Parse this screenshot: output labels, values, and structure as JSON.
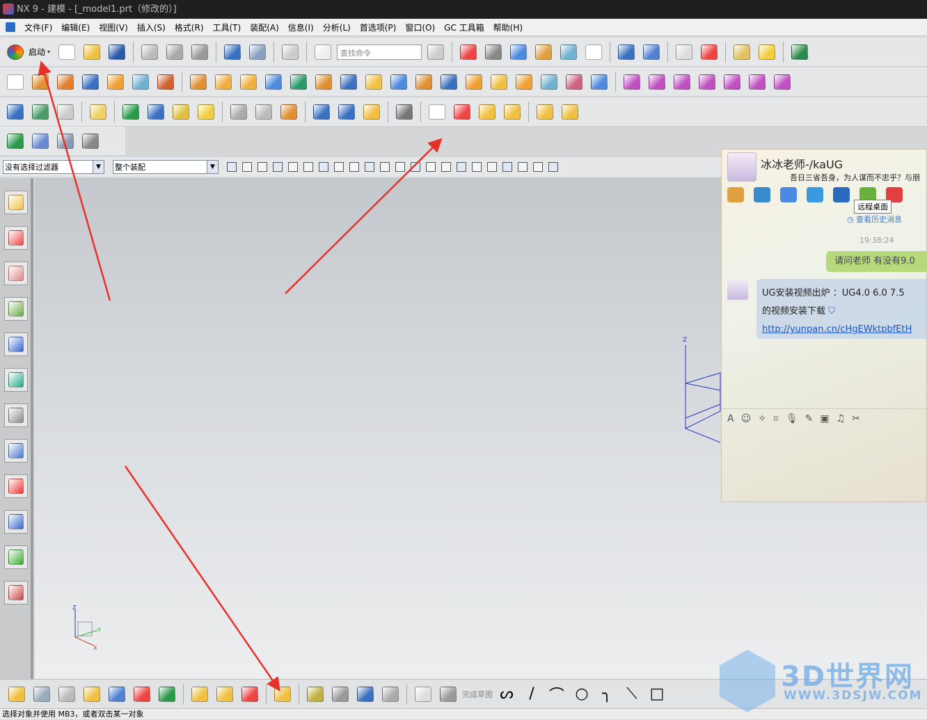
{
  "window": {
    "title": "NX 9 - 建模 - [_model1.prt（修改的）]"
  },
  "menu": [
    "文件(F)",
    "编辑(E)",
    "视图(V)",
    "插入(S)",
    "格式(R)",
    "工具(T)",
    "装配(A)",
    "信息(I)",
    "分析(L)",
    "首选项(P)",
    "窗口(O)",
    "GC 工具箱",
    "帮助(H)"
  ],
  "toolbar": {
    "start_label": "启动",
    "search_placeholder": "查找命令",
    "row1": [
      [
        "new-file",
        "#fff"
      ],
      [
        "open-folder",
        "#f0c040"
      ],
      [
        "save",
        "#2a5aa8"
      ],
      "|",
      [
        "cut",
        "#bbb"
      ],
      [
        "copy",
        "#aaa"
      ],
      [
        "paste",
        "#999"
      ],
      "|",
      [
        "undo",
        "#3a70c0"
      ],
      [
        "redo",
        "#8aa0c0"
      ],
      "|",
      [
        "repeat-command",
        "#ccc"
      ],
      "|",
      [
        "information",
        "#eee"
      ]
    ],
    "row1b": [
      [
        "fit-view",
        "#e44"
      ],
      [
        "render-style",
        "#888"
      ],
      [
        "shaded",
        "#4a8ae0"
      ],
      [
        "section",
        "#e0a040"
      ],
      [
        "view-orient",
        "#70b0d0"
      ],
      [
        "background",
        "#fff"
      ],
      "|",
      [
        "wcs",
        "#3a70c0"
      ],
      [
        "wcs-dynamic",
        "#5080d0"
      ],
      "|",
      [
        "layer-settings",
        "#ddd"
      ],
      [
        "snap",
        "#e44"
      ],
      "|",
      [
        "sketch",
        "#e0c060"
      ],
      [
        "paint",
        "#f0d040"
      ],
      "|",
      [
        "play",
        "#2a8a4a"
      ]
    ],
    "row2": [
      [
        "sketch-plane",
        "#fff"
      ],
      [
        "extrude",
        "#e09030"
      ],
      [
        "revolve",
        "#e08030"
      ],
      [
        "block",
        "#3a70c0"
      ],
      [
        "cylinder",
        "#f0a030"
      ],
      [
        "cone",
        "#70b0d0"
      ],
      [
        "sphere",
        "#d06030"
      ],
      "|",
      [
        "hole",
        "#e09030"
      ],
      [
        "boss",
        "#f0b040"
      ],
      [
        "pocket",
        "#f0b040"
      ],
      [
        "pad",
        "#4a8ae0"
      ],
      [
        "slot",
        "#2a9a6a"
      ],
      [
        "groove",
        "#e09030"
      ],
      [
        "thread",
        "#3a70c0"
      ],
      [
        "trim-body",
        "#f0c040"
      ],
      [
        "split-body",
        "#4a8ae0"
      ],
      [
        "sew",
        "#e09030"
      ],
      [
        "patch",
        "#3a70c0"
      ],
      [
        "edge-blend",
        "#f0a030"
      ],
      [
        "chamfer",
        "#f0c040"
      ],
      [
        "shell",
        "#f0a030"
      ],
      [
        "face-blend",
        "#70b0d0"
      ],
      [
        "draft",
        "#d06080"
      ],
      [
        "offset-face",
        "#4a8ae0"
      ],
      "|",
      [
        "move-face",
        "#c050c0"
      ],
      [
        "replace-face",
        "#c050c0"
      ],
      [
        "delete-face",
        "#c050c0"
      ],
      [
        "copy-face",
        "#c050c0"
      ],
      [
        "paste-face",
        "#c050c0"
      ],
      [
        "mirror-face",
        "#c050c0"
      ],
      [
        "pattern-face",
        "#c050c0"
      ]
    ],
    "row3": [
      [
        "assembly-nav",
        "#3a70c0"
      ],
      [
        "layers",
        "#4a9a6a"
      ],
      [
        "part-list",
        "#ccc"
      ],
      "|",
      [
        "label",
        "#f0d060"
      ],
      "|",
      [
        "check-geometry",
        "#2a9a4a"
      ],
      [
        "hammer",
        "#3a70c0"
      ],
      [
        "face-analysis",
        "#e0c040"
      ],
      [
        "text-note",
        "#f0d040"
      ],
      "|",
      [
        "curve-analysis",
        "#aaa"
      ],
      [
        "surface-analysis",
        "#bbb"
      ],
      [
        "draft-analysis",
        "#e09030"
      ],
      "|",
      [
        "spring",
        "#3a70c0"
      ],
      [
        "spring-coil",
        "#3a70c0"
      ],
      [
        "ring",
        "#f0c040"
      ],
      "|",
      [
        "tool",
        "#777"
      ],
      "|",
      [
        "triangle",
        "#fff"
      ],
      [
        "table",
        "#e44"
      ],
      [
        "folder-star",
        "#f0c040"
      ],
      [
        "settings-group",
        "#f0c040"
      ],
      "|",
      [
        "component-a",
        "#f0c040"
      ],
      [
        "component-b",
        "#f0c040"
      ]
    ],
    "row4": [
      [
        "check-mate",
        "#2a9a4a"
      ],
      [
        "assembly-constraint",
        "#6a8ad0"
      ],
      [
        "deformable",
        "#8a9ab0"
      ],
      [
        "csys",
        "#888"
      ]
    ]
  },
  "selection_bar": {
    "filter": "没有选择过滤器",
    "scope": "整个装配"
  },
  "left_toolbar": [
    "assembly-navigator",
    "constraint-navigator",
    "part-navigator",
    "reuse-library",
    "history",
    "web-browser",
    "history-clock",
    "process-studio",
    "visualization-palette",
    "roles-dynamic",
    "roles",
    "system-materials"
  ],
  "bottom_toolbar": {
    "items": [
      [
        "add-component",
        "#f0c040"
      ],
      [
        "wave-geometry",
        "#9ab"
      ],
      [
        "new-parent",
        "#bbb"
      ],
      [
        "create-array",
        "#f0c040"
      ],
      [
        "move-component",
        "#5080d0"
      ],
      [
        "mirror-assembly",
        "#e44"
      ],
      [
        "assembly-constraints",
        "#2a9a4a"
      ],
      "|",
      [
        "explode",
        "#f0c040"
      ],
      [
        "sequence",
        "#f0c040"
      ],
      [
        "replace-component",
        "#e44"
      ],
      "|",
      [
        "product-interface",
        "#f0c040"
      ],
      "|",
      [
        "link",
        "#c0b040"
      ],
      [
        "wave-link",
        "#999"
      ],
      [
        "wave-info",
        "#3a70c0"
      ],
      [
        "clearance",
        "#aaa"
      ],
      "|",
      [
        "sketch-new",
        "#ddd"
      ],
      [
        "finish-sketch-grid",
        "#999"
      ]
    ],
    "finish_sketch_label": "完成草图",
    "sketch_tools": [
      "profile",
      "line",
      "arc",
      "circle",
      "fillet",
      "chamfer",
      "rectangle"
    ]
  },
  "status_bar": {
    "text": "选择对象并使用 MB3，或者双击某一对象"
  },
  "chat": {
    "name": "冰冰老师-/kaUG",
    "signature": "吾日三省吾身，为人谋而不忠乎？与朋",
    "tooltip": "远程桌面",
    "history_link": "查看历史消息",
    "time": "19:38:24",
    "my_message": "请问老师  有没有9.0",
    "their_line1": "UG安装视频出炉  ：UG4.0  6.0  7.5",
    "their_line2": "的视频安装下载",
    "their_link": "http://yunpan.cn/cHgEWktpbfEtH",
    "tools": [
      [
        "microphone",
        "#e0a040"
      ],
      [
        "webcam",
        "#3a8ad0"
      ],
      [
        "screen-share",
        "#4a8ae0"
      ],
      [
        "send-file",
        "#3a9ae0"
      ],
      [
        "remote-desktop",
        "#2a6ac0"
      ],
      [
        "note-add",
        "#6ab040"
      ],
      [
        "apps",
        "#e04040"
      ]
    ]
  },
  "watermark": {
    "title": "3D世界网",
    "url": "WWW.3DSJW.COM"
  },
  "colors": {
    "annotation_arrow": "#e8302a",
    "titlebar": "#1f1f1f",
    "link": "#1a56c0"
  }
}
